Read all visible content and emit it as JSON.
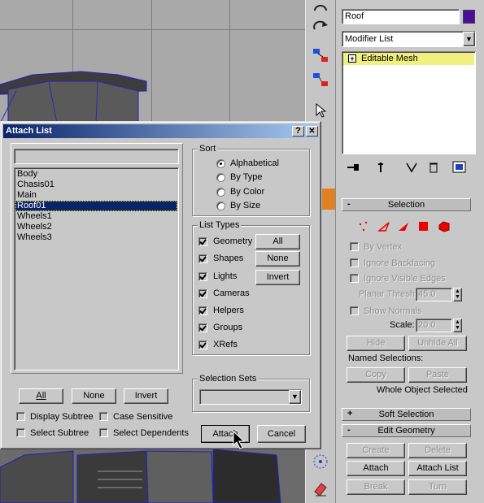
{
  "dialog": {
    "title": "Attach List",
    "help_label": "?",
    "close_label": "✕",
    "filter_value": "",
    "objects": [
      "Body",
      "Chasis01",
      "Main",
      "Roof01",
      "Wheels1",
      "Wheels2",
      "Wheels3"
    ],
    "selected_object": "Roof01",
    "sort": {
      "label": "Sort",
      "options": [
        "Alphabetical",
        "By Type",
        "By Color",
        "By Size"
      ],
      "selected": "Alphabetical"
    },
    "list_types": {
      "label": "List Types",
      "items": [
        {
          "label": "Geometry",
          "checked": true
        },
        {
          "label": "Shapes",
          "checked": true
        },
        {
          "label": "Lights",
          "checked": true
        },
        {
          "label": "Cameras",
          "checked": true
        },
        {
          "label": "Helpers",
          "checked": true
        },
        {
          "label": "Groups",
          "checked": true
        },
        {
          "label": "XRefs",
          "checked": true
        }
      ],
      "all_label": "All",
      "none_label": "None",
      "invert_label": "Invert"
    },
    "selection_sets": {
      "label": "Selection Sets",
      "value": ""
    },
    "list_buttons": {
      "all": "All",
      "none": "None",
      "invert": "Invert"
    },
    "options": {
      "display_subtree": "Display Subtree",
      "case_sensitive": "Case Sensitive",
      "select_subtree": "Select Subtree",
      "select_dependents": "Select Dependents"
    },
    "attach_label": "Attach",
    "cancel_label": "Cancel"
  },
  "command_panel": {
    "object_name": "Roof",
    "object_color": "#4b0f9a",
    "modifier_list_label": "Modifier List",
    "stack_item": "Editable Mesh",
    "stack_item_color": "#f0f080",
    "selection_rollout": {
      "title": "Selection",
      "by_vertex": "By Vertex",
      "ignore_backfacing": "Ignore Backfacing",
      "ignore_visible_edges": "Ignore Visible Edges",
      "planar_thresh_label": "Planar Thresh:",
      "planar_thresh_value": "45.0",
      "show_normals": "Show Normals",
      "scale_label": "Scale:",
      "scale_value": "20.0",
      "hide_label": "Hide",
      "unhide_all_label": "Unhide All",
      "named_selections_label": "Named Selections:",
      "copy_label": "Copy",
      "paste_label": "Paste",
      "status": "Whole Object Selected"
    },
    "soft_selection_title": "Soft Selection",
    "edit_geometry": {
      "title": "Edit Geometry",
      "create_label": "Create",
      "delete_label": "Delete",
      "attach_label": "Attach",
      "attach_list_label": "Attach List",
      "break_label": "Break",
      "turn_label": "Turn"
    }
  }
}
